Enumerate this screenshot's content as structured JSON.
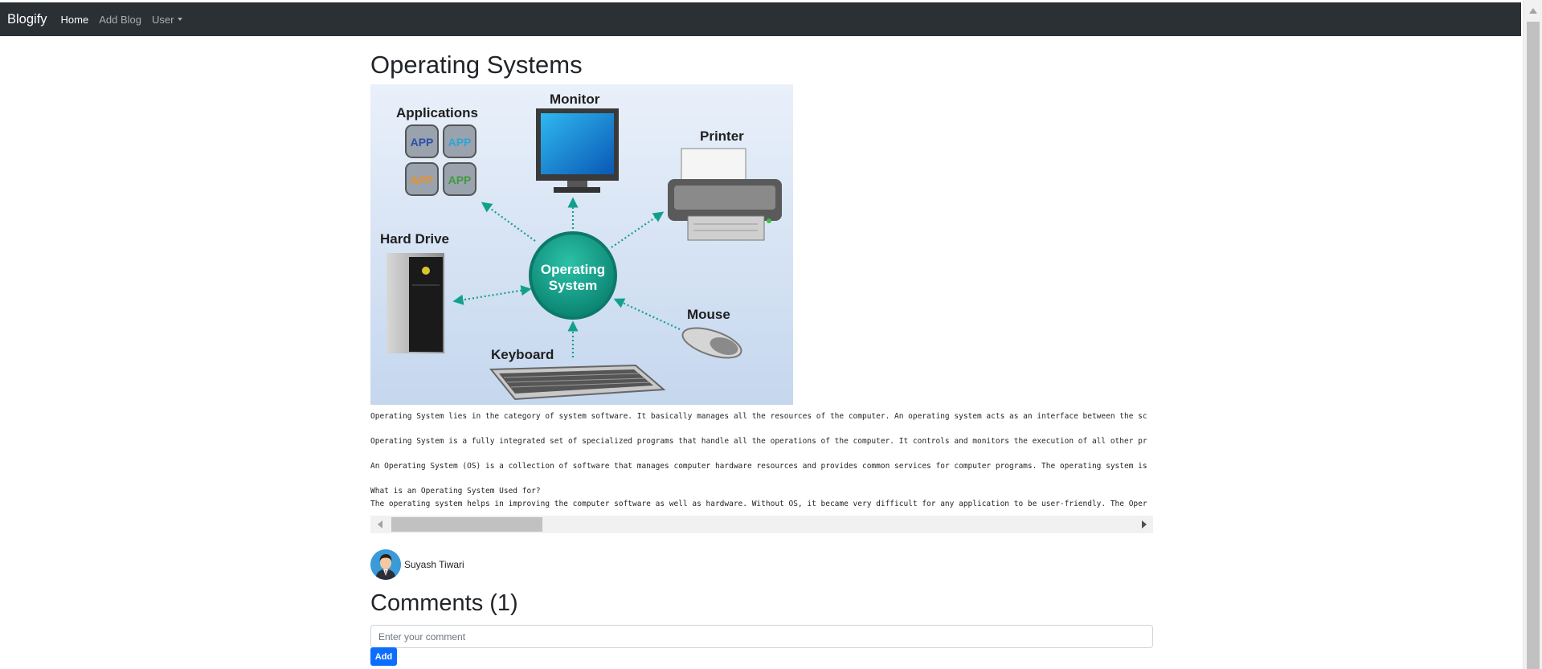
{
  "navbar": {
    "brand": "Blogify",
    "links": [
      {
        "label": "Home",
        "active": true
      },
      {
        "label": "Add Blog",
        "active": false
      },
      {
        "label": "User",
        "active": false,
        "dropdown": true
      }
    ]
  },
  "post": {
    "title": "Operating Systems",
    "image": {
      "labels": {
        "applications": "Applications",
        "monitor": "Monitor",
        "printer": "Printer",
        "hard_drive": "Hard Drive",
        "os_line1": "Operating",
        "os_line2": "System",
        "mouse": "Mouse",
        "keyboard": "Keyboard",
        "app": "APP"
      }
    },
    "body_lines": [
      "Operating System lies in the category of system software. It basically manages all the resources of the computer. An operating system acts as an interface between the sc",
      "",
      "Operating System is a fully integrated set of specialized programs that handle all the operations of the computer. It controls and monitors the execution of all other pr",
      "",
      "An Operating System (OS) is a collection of software that manages computer hardware resources and provides common services for computer programs. The operating system is",
      "",
      "What is an Operating System Used for?",
      "The operating system helps in improving the computer software as well as hardware. Without OS, it became very difficult for any application to be user-friendly. The Oper"
    ]
  },
  "author": {
    "name": "Suyash Tiwari"
  },
  "comments": {
    "title": "Comments (1)",
    "input_placeholder": "Enter your comment",
    "add_label": "Add"
  },
  "colors": {
    "navbar_bg": "#2b3035",
    "primary": "#0d6efd",
    "os_circle": "#12a08c"
  }
}
